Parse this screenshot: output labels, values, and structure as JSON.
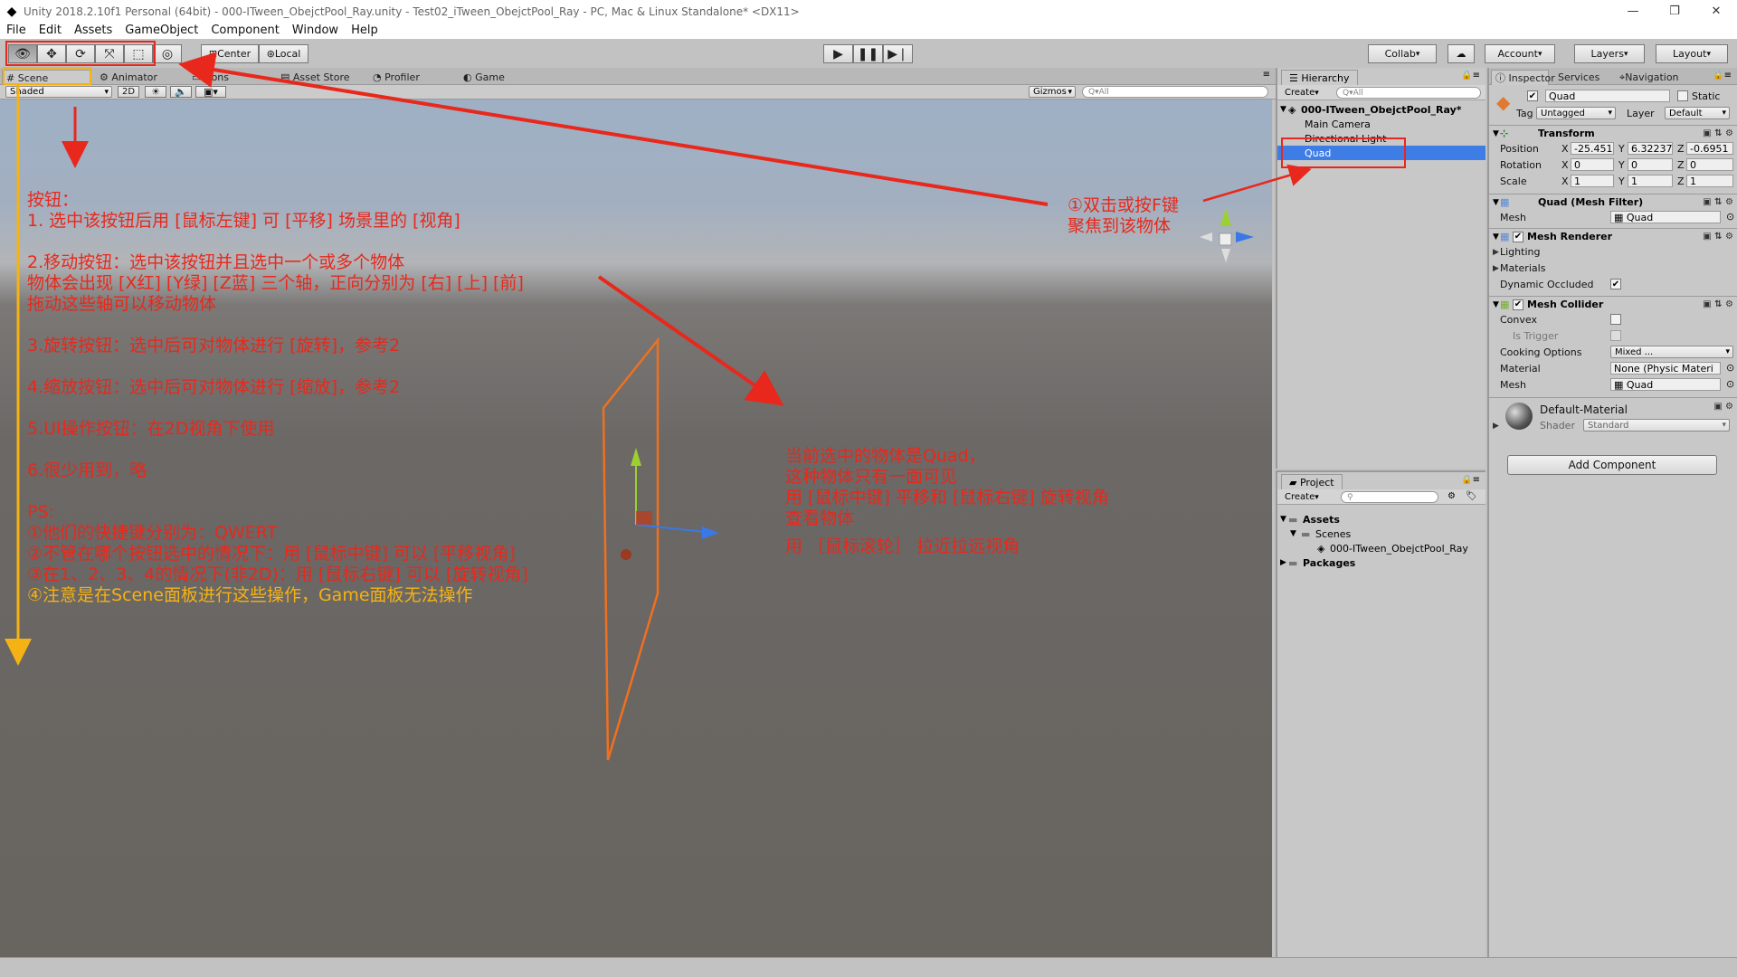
{
  "window": {
    "title": "Unity 2018.2.10f1 Personal (64bit) - 000-ITween_ObejctPool_Ray.unity - Test02_iTween_ObejctPool_Ray - PC, Mac & Linux Standalone* <DX11>",
    "controls": [
      "—",
      "❐",
      "✕"
    ]
  },
  "menu": [
    "File",
    "Edit",
    "Assets",
    "GameObject",
    "Component",
    "Window",
    "Help"
  ],
  "toolbar": {
    "pivot_center": "Center",
    "pivot_local": "Local",
    "collab": "Collab",
    "account": "Account",
    "layers": "Layers",
    "layout": "Layout"
  },
  "scene_tabs": [
    "Scene",
    "Animator",
    "Cons",
    "Asset Store",
    "Profiler",
    "Game"
  ],
  "scene_bar": {
    "shading": "Shaded",
    "mode_2d": "2D",
    "gizmos": "Gizmos",
    "search_placeholder": "Q▾All"
  },
  "hierarchy": {
    "tab": "Hierarchy",
    "create": "Create",
    "search_placeholder": "Q▾All",
    "scene_name": "000-ITween_ObejctPool_Ray*",
    "items": [
      "Main Camera",
      "Directional Light",
      "Quad"
    ]
  },
  "project": {
    "tab": "Project",
    "create": "Create",
    "tree": [
      "Assets",
      "Scenes",
      "000-ITween_ObejctPool_Ray",
      "Packages"
    ]
  },
  "inspector": {
    "tabs": [
      "Inspector",
      "Services",
      "Navigation"
    ],
    "object_name": "Quad",
    "static_label": "Static",
    "tag_label": "Tag",
    "tag_value": "Untagged",
    "layer_label": "Layer",
    "layer_value": "Default",
    "transform": {
      "title": "Transform",
      "position_label": "Position",
      "rotation_label": "Rotation",
      "scale_label": "Scale",
      "position": [
        "-25.451",
        "6.32237",
        "-0.6951"
      ],
      "rotation": [
        "0",
        "0",
        "0"
      ],
      "scale": [
        "1",
        "1",
        "1"
      ]
    },
    "mesh_filter": {
      "title": "Quad (Mesh Filter)",
      "mesh_label": "Mesh",
      "mesh_value": "Quad"
    },
    "mesh_renderer": {
      "title": "Mesh Renderer",
      "lighting": "Lighting",
      "materials": "Materials",
      "dynamic_occluded": "Dynamic Occluded"
    },
    "mesh_collider": {
      "title": "Mesh Collider",
      "convex": "Convex",
      "is_trigger": "Is Trigger",
      "cooking_label": "Cooking Options",
      "cooking_value": "Mixed ...",
      "material_label": "Material",
      "material_value": "None (Physic Materi",
      "mesh_label": "Mesh",
      "mesh_value": "Quad"
    },
    "material": {
      "name": "Default-Material",
      "shader_label": "Shader",
      "shader_value": "Standard"
    },
    "add_component": "Add Component"
  },
  "annotations": {
    "left": [
      "按钮：",
      "1. 选中该按钮后用 [鼠标左键] 可 [平移] 场景里的 [视角]",
      "",
      "2.移动按钮：选中该按钮并且选中一个或多个物体",
      "物体会出现 [X红] [Y绿] [Z蓝] 三个轴，正向分别为 [右] [上] [前]",
      "拖动这些轴可以移动物体",
      "",
      "3.旋转按钮：选中后可对物体进行 [旋转]，参考2",
      "",
      "4.缩放按钮：选中后可对物体进行 [缩放]，参考2",
      "",
      "5.UI操作按钮：在2D视角下使用",
      "",
      "6.很少用到，略",
      "",
      "PS:",
      "①他们的快捷键分别为：QWERT",
      "②不管在哪个按钮选中的情况下：用 [鼠标中键] 可以 [平移视角]",
      "③在1、2、3、4的情况下(非2D)：用 [鼠标右键] 可以 [旋转视角]"
    ],
    "left_yellow": "④注意是在Scene面板进行这些操作，Game面板无法操作",
    "middle": [
      "当前选中的物体是Quad，",
      "这种物体只有一面可见",
      "用 [鼠标中键] 平移和 [鼠标右键] 旋转视角",
      "查看物体",
      "用 ［鼠标滚轮］ 拉近拉远视角"
    ],
    "right": [
      "①双击或按F键",
      "聚焦到该物体"
    ]
  },
  "colors": {
    "annotation_red": "#e8281c",
    "annotation_yellow": "#f5b214",
    "selection_blue": "#3e7de6",
    "quad_outline": "#f07020"
  }
}
